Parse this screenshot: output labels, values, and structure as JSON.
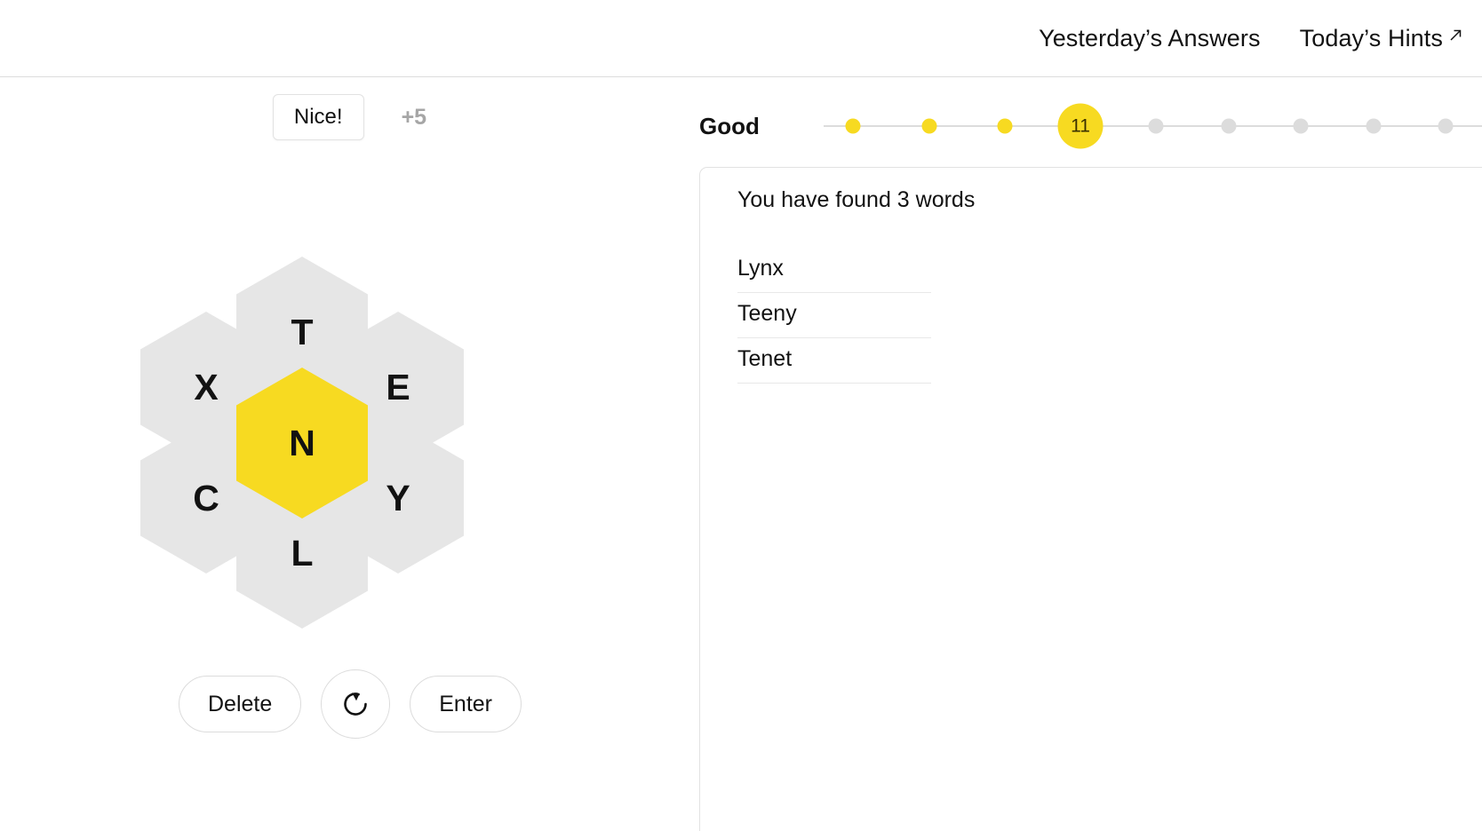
{
  "header": {
    "links": [
      {
        "label": "Yesterday’s Answers",
        "icon": ""
      },
      {
        "label": "Today’s Hints",
        "icon": "external-link-icon"
      }
    ]
  },
  "game": {
    "message": "Nice!",
    "score_delta": "+5",
    "hive": {
      "center": {
        "letter": "N",
        "position": "center",
        "is_center": true
      },
      "outer": [
        {
          "letter": "T",
          "position": "top"
        },
        {
          "letter": "E",
          "position": "topright"
        },
        {
          "letter": "Y",
          "position": "botright"
        },
        {
          "letter": "L",
          "position": "bottom"
        },
        {
          "letter": "C",
          "position": "botleft"
        },
        {
          "letter": "X",
          "position": "topleft"
        }
      ]
    },
    "controls": {
      "delete_label": "Delete",
      "shuffle_icon": "shuffle-refresh-icon",
      "enter_label": "Enter"
    },
    "colors": {
      "center_hex": "#f7da21",
      "outer_hex": "#e6e6e6",
      "accent": "#f7da21"
    }
  },
  "progress": {
    "rank_label": "Good",
    "current_score": "11",
    "dots": [
      {
        "state": "reached",
        "label": ""
      },
      {
        "state": "reached",
        "label": ""
      },
      {
        "state": "reached",
        "label": ""
      },
      {
        "state": "current",
        "label": "11"
      },
      {
        "state": "upcoming",
        "label": ""
      },
      {
        "state": "upcoming",
        "label": ""
      },
      {
        "state": "upcoming",
        "label": ""
      },
      {
        "state": "upcoming",
        "label": ""
      },
      {
        "state": "upcoming",
        "label": ""
      }
    ]
  },
  "wordlist": {
    "found_count_text": "You have found 3 words",
    "words": [
      "Lynx",
      "Teeny",
      "Tenet"
    ]
  }
}
